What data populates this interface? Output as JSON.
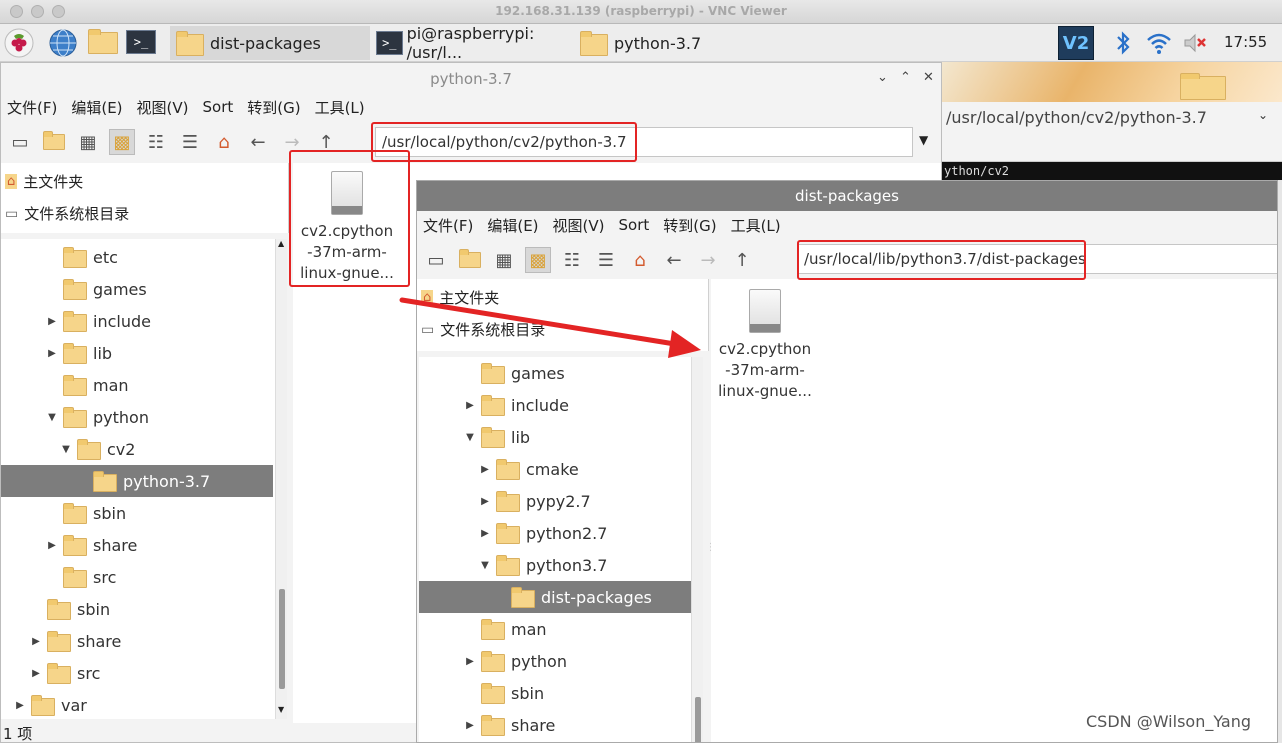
{
  "vnc": {
    "title": "192.168.31.139 (raspberrypi) - VNC Viewer"
  },
  "taskbar": {
    "tasks": [
      "dist-packages",
      "pi@raspberrypi: /usr/l...",
      "python-3.7"
    ],
    "clock": "17:55"
  },
  "back_window": {
    "title": "python-3.7",
    "menus": [
      "文件(F)",
      "编辑(E)",
      "视图(V)",
      "Sort",
      "转到(G)",
      "工具(L)"
    ],
    "path": "/usr/local/python/cv2/python-3.7",
    "places": [
      "主文件夹",
      "文件系统根目录"
    ],
    "tree": [
      {
        "label": "etc"
      },
      {
        "label": "games"
      },
      {
        "label": "include"
      },
      {
        "label": "lib"
      },
      {
        "label": "man"
      },
      {
        "label": "python"
      },
      {
        "label": "cv2"
      },
      {
        "label": "python-3.7"
      },
      {
        "label": "sbin"
      },
      {
        "label": "share"
      },
      {
        "label": "src"
      },
      {
        "label": "sbin"
      },
      {
        "label": "share"
      },
      {
        "label": "src"
      },
      {
        "label": "var"
      }
    ],
    "file": {
      "line1": "cv2.cpython",
      "line2": "-37m-arm-",
      "line3": "linux-gnue..."
    },
    "status": "1 项"
  },
  "behind_window": {
    "path": "/usr/local/python/cv2/python-3.7",
    "terminal_text": "ython/cv2"
  },
  "front_window": {
    "title": "dist-packages",
    "menus": [
      "文件(F)",
      "编辑(E)",
      "视图(V)",
      "Sort",
      "转到(G)",
      "工具(L)"
    ],
    "path": "/usr/local/lib/python3.7/dist-packages",
    "places": [
      "主文件夹",
      "文件系统根目录"
    ],
    "tree": [
      {
        "label": "games"
      },
      {
        "label": "include"
      },
      {
        "label": "lib"
      },
      {
        "label": "cmake"
      },
      {
        "label": "pypy2.7"
      },
      {
        "label": "python2.7"
      },
      {
        "label": "python3.7"
      },
      {
        "label": "dist-packages"
      },
      {
        "label": "man"
      },
      {
        "label": "python"
      },
      {
        "label": "sbin"
      },
      {
        "label": "share"
      }
    ],
    "file": {
      "line1": "cv2.cpython",
      "line2": "-37m-arm-",
      "line3": "linux-gnue..."
    }
  },
  "watermark": "CSDN @Wilson_Yang",
  "colors": {
    "annotation": "#e32424",
    "selection": "#7d7d7d",
    "folder": "#f6d58a"
  }
}
